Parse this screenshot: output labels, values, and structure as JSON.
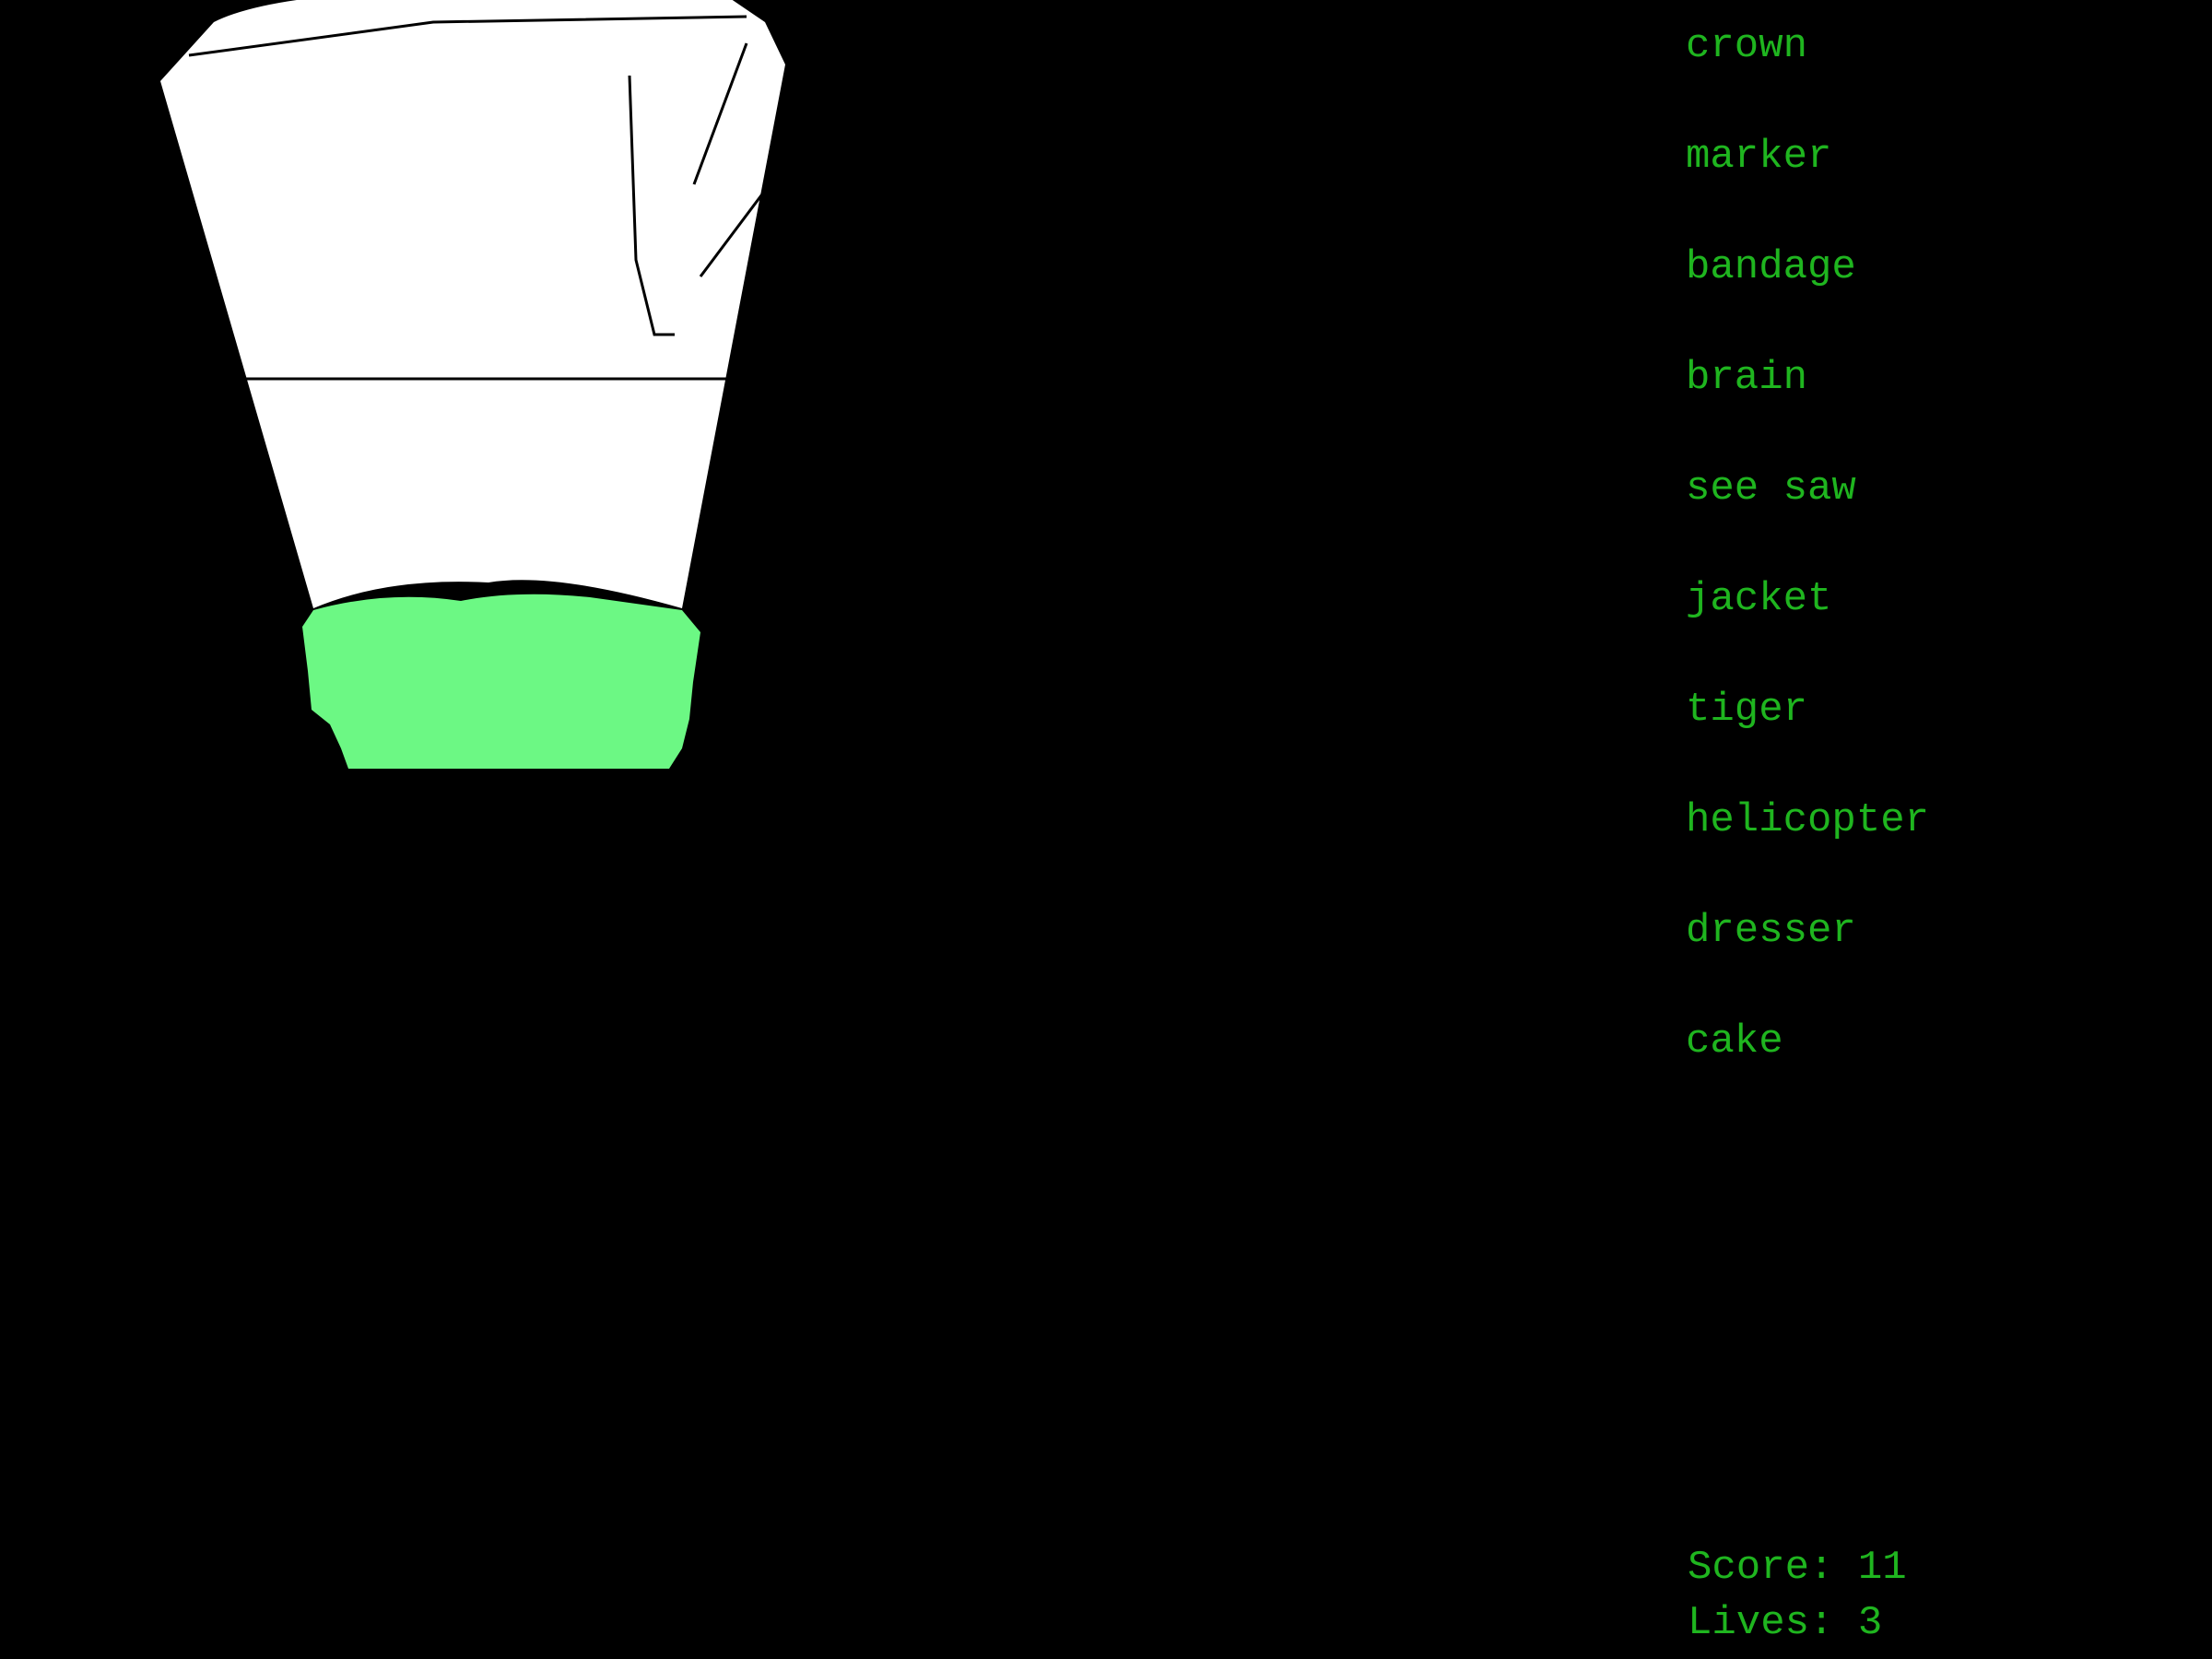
{
  "colors": {
    "background": "#000000",
    "text": "#1fb51f",
    "drawing_fill": "#ffffff",
    "drawing_stroke": "#000000",
    "paddle": "#6cf884"
  },
  "drawing": {
    "subject_icon": "doodle-sketch-icon",
    "paddle_icon": "green-blob-icon"
  },
  "words": [
    "crown",
    "marker",
    "bandage",
    "brain",
    "see saw",
    "jacket",
    "tiger",
    "helicopter",
    "dresser",
    "cake"
  ],
  "hud": {
    "score_label": "Score:",
    "score_value": "11",
    "lives_label": "Lives:",
    "lives_value": "3"
  }
}
